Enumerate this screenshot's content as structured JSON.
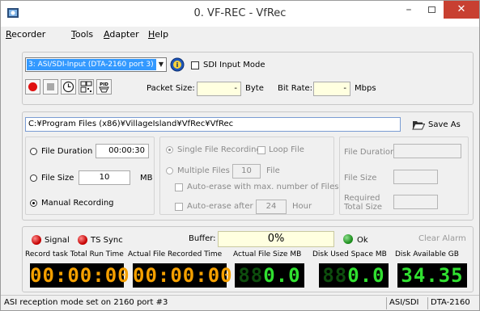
{
  "window": {
    "title": "0. VF-REC - VfRec"
  },
  "menu": [
    {
      "accel": "R",
      "rest": "ecorder"
    },
    {
      "accel": "T",
      "rest": "ools"
    },
    {
      "accel": "A",
      "rest": "dapter"
    },
    {
      "accel": "H",
      "rest": "elp"
    }
  ],
  "input": {
    "selected": "3: ASI/SDI-Input (DTA-2160 port 3)",
    "sdi_mode_label": "SDI Input Mode",
    "sdi_mode_checked": false,
    "packet_size_label": "Packet Size:",
    "packet_size_value": "-",
    "packet_size_unit": "Byte",
    "bit_rate_label": "Bit Rate:",
    "bit_rate_value": "-",
    "bit_rate_unit": "Mbps"
  },
  "file": {
    "path": "C:¥Program Files (x86)¥VillageIsland¥VfRec¥VfRec",
    "save_as_label": "Save As"
  },
  "record_mode": {
    "file_duration_label": "File Duration",
    "file_duration_value": "00:00:30",
    "file_size_label": "File Size",
    "file_size_value": "10",
    "file_size_unit": "MB",
    "manual_label": "Manual Recording",
    "selected": "manual"
  },
  "split": {
    "single_label": "Single File Recording",
    "loop_label": "Loop File",
    "multiple_label": "Multiple Files",
    "multiple_value": "10",
    "multiple_unit": "File",
    "auto_erase_max_label": "Auto-erase with max. number of Files",
    "auto_erase_after_label": "Auto-erase after",
    "auto_erase_after_value": "24",
    "auto_erase_after_unit": "Hour"
  },
  "info": {
    "file_duration_label": "File Duration",
    "file_size_label": "File Size",
    "required_label_1": "Required",
    "required_label_2": "Total Size"
  },
  "status_panel": {
    "signal_label": "Signal",
    "ts_sync_label": "TS Sync",
    "buffer_label": "Buffer:",
    "buffer_value": "0%",
    "buffer_fraction": 0,
    "ok_label": "Ok",
    "clear_alarm_label": "Clear Alarm",
    "colors": {
      "error": "#c40000",
      "ok": "#1c8c1c",
      "amber": "#f5a000",
      "green": "#30e030"
    }
  },
  "meters": {
    "h_record_task": "Record task Total Run Time",
    "h_actual_time": "Actual File Recorded Time",
    "h_actual_size": "Actual File Size  MB",
    "h_disk_used": "Disk Used Space  MB",
    "h_disk_avail": "Disk Available   GB",
    "run_time": "00:00:00",
    "recorded_time": "00:00:00",
    "file_size_dim": "88",
    "file_size": "0.0",
    "disk_used_dim": "88",
    "disk_used": "0.0",
    "disk_available": "34.35"
  },
  "statusbar": {
    "message": "ASI reception mode set on 2160 port #3",
    "mode": "ASI/SDI",
    "device": "DTA-2160"
  },
  "icons": [
    "app-icon",
    "minimize-icon",
    "maximize-icon",
    "close-icon",
    "dropdown-arrow-icon",
    "info-icon",
    "record-icon",
    "stop-icon",
    "schedule-clock-icon",
    "grid-icon",
    "pid-icon",
    "folder-open-icon"
  ]
}
